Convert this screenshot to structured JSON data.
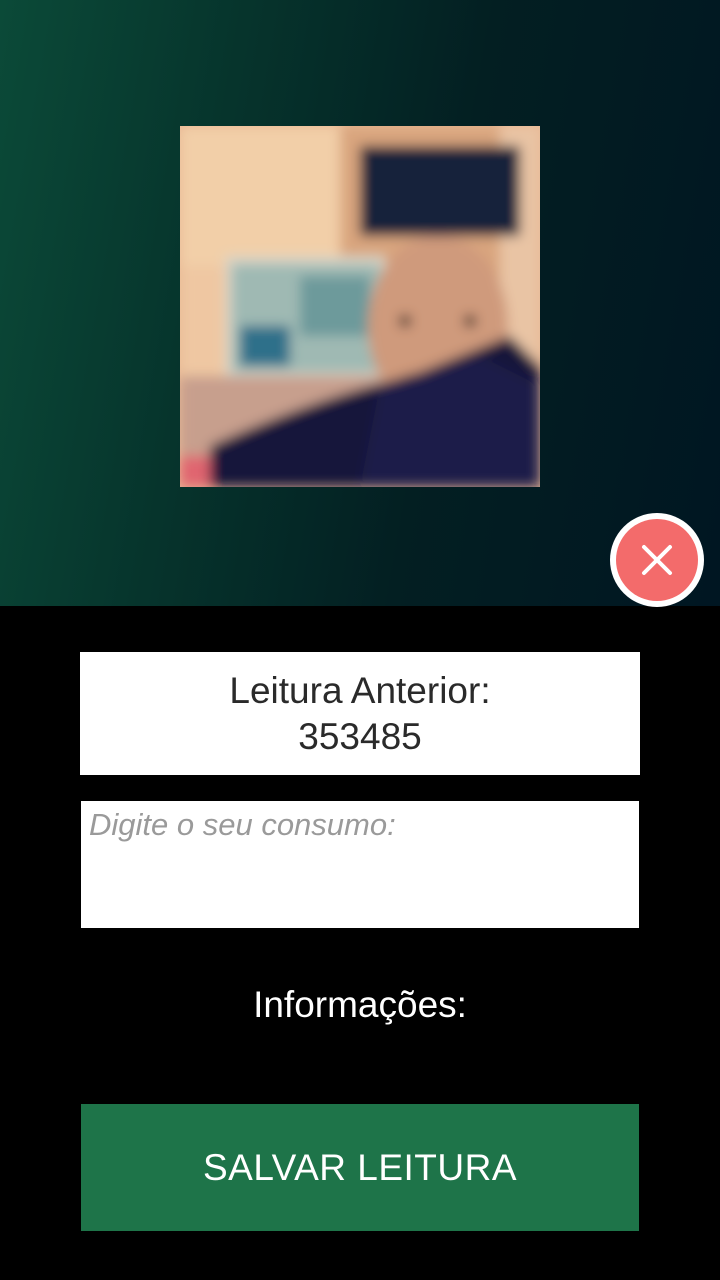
{
  "profile": {
    "photo_icon": "user-photo"
  },
  "close_button": {
    "icon": "close-icon",
    "color": "#f36b6b"
  },
  "previous_reading": {
    "label": "Leitura Anterior:",
    "value": "353485"
  },
  "consumption_input": {
    "placeholder": "Digite o seu consumo:",
    "value": ""
  },
  "info": {
    "label": "Informações:"
  },
  "save_button": {
    "label": "SALVAR LEITURA",
    "color": "#1e7449"
  },
  "colors": {
    "header_gradient_start": "#0b4a38",
    "header_gradient_end": "#001622",
    "background": "#000000"
  }
}
